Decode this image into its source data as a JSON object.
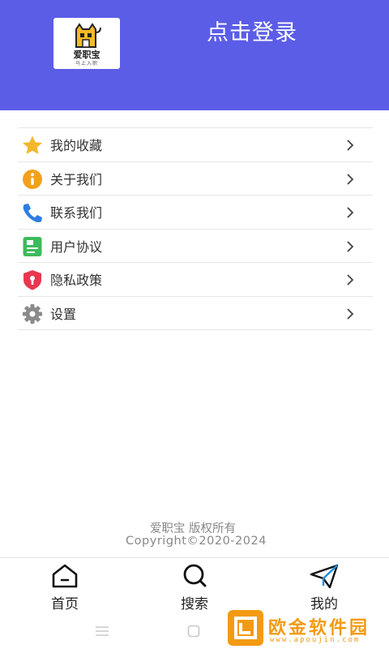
{
  "header": {
    "login_title": "点击登录",
    "logo_name": "爱职宝",
    "logo_tagline": "马上入职",
    "bg_color": "#5b5de6"
  },
  "menu": {
    "items": [
      {
        "label": "我的收藏",
        "icon": "star-icon",
        "color": "#f2b72d"
      },
      {
        "label": "关于我们",
        "icon": "info-icon",
        "color": "#f3a018"
      },
      {
        "label": "联系我们",
        "icon": "phone-icon",
        "color": "#2f7de1"
      },
      {
        "label": "用户协议",
        "icon": "document-icon",
        "color": "#3dbb5a"
      },
      {
        "label": "隐私政策",
        "icon": "shield-lock-icon",
        "color": "#e8384f"
      },
      {
        "label": "设置",
        "icon": "gear-icon",
        "color": "#8a8a8a"
      }
    ]
  },
  "footer": {
    "brand": "爱职宝 版权所有",
    "copyright": "Copyright©2020-2024"
  },
  "tabbar": {
    "tabs": [
      {
        "label": "首页",
        "icon": "home-icon"
      },
      {
        "label": "搜索",
        "icon": "search-icon"
      },
      {
        "label": "我的",
        "icon": "paper-plane-icon",
        "active": true
      }
    ]
  },
  "watermark": {
    "text": "欧金软件园",
    "url": "www.apoujin.com",
    "color": "#f39a12"
  }
}
